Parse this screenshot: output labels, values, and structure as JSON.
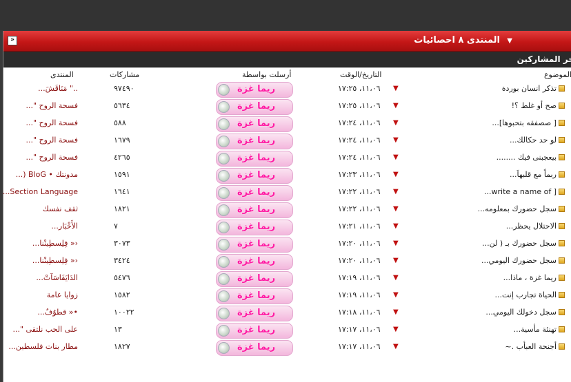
{
  "header": {
    "title": "المنتدى ٨ احصائيات",
    "collapse_symbol": "»",
    "subtitle": "آخر المشاركين"
  },
  "columns": {
    "topic": "الموضوع",
    "date": "التاريخ/الوقت",
    "poster": "أرسلت بواسطة",
    "posts": "مشاركات",
    "forum": "المنتدى"
  },
  "rows": [
    {
      "topic": "تذكر انسان بوردة",
      "date": "١١،٠٦، ١٧:٢٥",
      "poster": "ريما غزة",
      "posts": "٩٧٤٩٠",
      "forum": "..\" مَنَاقَشَ..."
    },
    {
      "topic": "صح أو غلط ؟!",
      "date": "١١،٠٦، ١٧:٢٥",
      "poster": "ريما غزة",
      "posts": "٥٦٣٤",
      "forum": "فسحة الروح \"..."
    },
    {
      "topic": "[ صصفقه بتحبوها]...",
      "date": "١١،٠٦، ١٧:٢٤",
      "poster": "ريما غزة",
      "posts": "٥٨٨",
      "forum": "فسحة الروح \"..."
    },
    {
      "topic": "لو حد حكالك...",
      "date": "١١،٠٦، ١٧:٢٤",
      "poster": "ريما غزة",
      "posts": "١٦٧٩",
      "forum": "فسحة الروح \"..."
    },
    {
      "topic": "بيعجبنى فيك ........",
      "date": "١١،٠٦، ١٧:٢٤",
      "poster": "ريما غزة",
      "posts": "٤٢٦٥",
      "forum": "فسحة الروح \"..."
    },
    {
      "topic": "ربماً مع قلبهاَ...",
      "date": "١١،٠٦، ١٧:٢٣",
      "poster": "ريما غزة",
      "posts": "١٥٩١",
      "forum": "مدونتك • BloG (..."
    },
    {
      "topic": "[ write a name of...",
      "date": "١١،٠٦، ١٧:٢٢",
      "poster": "ريما غزة",
      "posts": "١٦٤١",
      "forum": "Section Language..."
    },
    {
      "topic": "سجل حضورك بمعلومه...",
      "date": "١١،٠٦، ١٧:٢٢",
      "poster": "ريما غزة",
      "posts": "١٨٢١",
      "forum": "ثقف نفسك"
    },
    {
      "topic": "الاحتلال يحظر...",
      "date": "١١،٠٦، ١٧:٢١",
      "poster": "ريما غزة",
      "posts": "٧",
      "forum": "الأَخْبَار..."
    },
    {
      "topic": "سجل حضورك بـ ( لن...",
      "date": "١١،٠٦، ١٧:٢٠",
      "poster": "ريما غزة",
      "posts": "٣٠٧٣",
      "forum": "‹« فِلِسطِينْنا..."
    },
    {
      "topic": "سجل حضورك اليومي...",
      "date": "١١،٠٦، ١٧:٢٠",
      "poster": "ريما غزة",
      "posts": "٣٤٢٤",
      "forum": "‹« فِلِسطِينْنا..."
    },
    {
      "topic": "ريما غزة ، ماذا...",
      "date": "١١،٠٦، ١٧:١٩",
      "poster": "ريما غزة",
      "posts": "٥٤٧٦",
      "forum": "الدَايَفَاسَآتْ..."
    },
    {
      "topic": "الحياة تجارب إنت...",
      "date": "١١،٠٦، ١٧:١٩",
      "poster": "ريما غزة",
      "posts": "١٥٨٢",
      "forum": "زوايا عامة"
    },
    {
      "topic": "سجل دخولك اليومي...",
      "date": "١١،٠٦، ١٧:١٨",
      "poster": "ريما غزة",
      "posts": "١٠٠٢٢",
      "forum": "•« قطوُفٌ..."
    },
    {
      "topic": "تهنئة مأسية...",
      "date": "١١،٠٦، ١٧:١٧",
      "poster": "ريما غزة",
      "posts": "١٣",
      "forum": "على الحب نلتقى \"..."
    },
    {
      "topic": "أجنحة العبأب .~",
      "date": "١١،٠٦، ١٧:١٧",
      "poster": "ريما غزة",
      "posts": "١٨٢٧",
      "forum": "مطار بنات فلسطين..."
    }
  ]
}
